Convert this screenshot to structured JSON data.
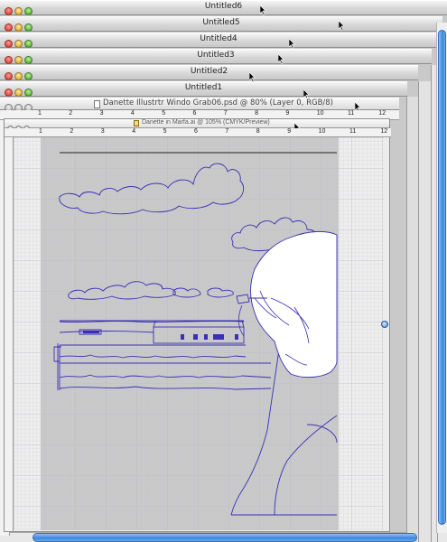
{
  "windows": [
    {
      "title": "Untitled6"
    },
    {
      "title": "Untitled5"
    },
    {
      "title": "Untitled4"
    },
    {
      "title": "Untitled3"
    },
    {
      "title": "Untitled2"
    },
    {
      "title": "Untitled1"
    }
  ],
  "psd_window": {
    "title": "Danette Illustrtr Windo Grab06.psd @ 80% (Layer 0, RGB/8)"
  },
  "ai_window": {
    "title": "Danette in Marfa.ai @ 105% (CMYK/Preview)"
  },
  "psd_ruler_numbers": [
    "1",
    "2",
    "3",
    "4",
    "5",
    "6",
    "7",
    "8",
    "9",
    "10",
    "11",
    "12"
  ],
  "ai_ruler_numbers": [
    "1",
    "2",
    "3",
    "4",
    "5",
    "6",
    "7",
    "8",
    "9",
    "10",
    "11",
    "12"
  ],
  "colors": {
    "artwork_line": "#3a2fb5",
    "canvas": "#c6c6c6",
    "scroll_accent": "#3b86e0"
  }
}
